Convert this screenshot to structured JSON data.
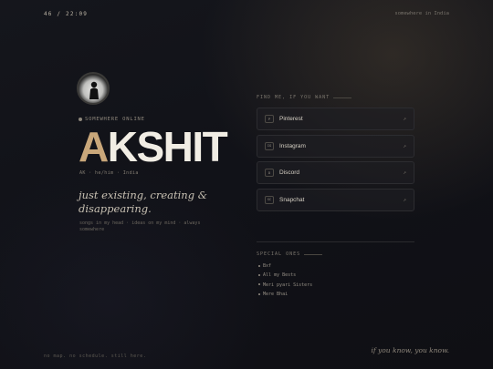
{
  "header": {
    "time": "46 / 22:09",
    "location": "somewhere in India"
  },
  "profile": {
    "status": "SOMEWHERE ONLINE",
    "name_initial": "A",
    "name_rest": "KSHIT",
    "meta": "AK · he/him · India",
    "tagline": "just existing, creating & disappearing.",
    "description": "songs in my head · ideas on my mind · always somewhere"
  },
  "links_section": {
    "title": "FIND ME, IF YOU WANT",
    "items": [
      {
        "key": "P",
        "label": "Pinterest",
        "icon": "pinterest-icon"
      },
      {
        "key": "IG",
        "label": "Instagram",
        "icon": "instagram-icon"
      },
      {
        "key": "D",
        "label": "Discord",
        "icon": "discord-icon"
      },
      {
        "key": "SC",
        "label": "Snapchat",
        "icon": "snapchat-icon"
      }
    ],
    "arrow": "↗"
  },
  "special": {
    "title": "SPECIAL ONES",
    "items": [
      "Bxf",
      "All my Bests",
      "Meri pyari Sisters",
      "Mere Bhai"
    ]
  },
  "footer": {
    "left": "no map. no schedule. still here.",
    "right": "if you know, you know."
  }
}
